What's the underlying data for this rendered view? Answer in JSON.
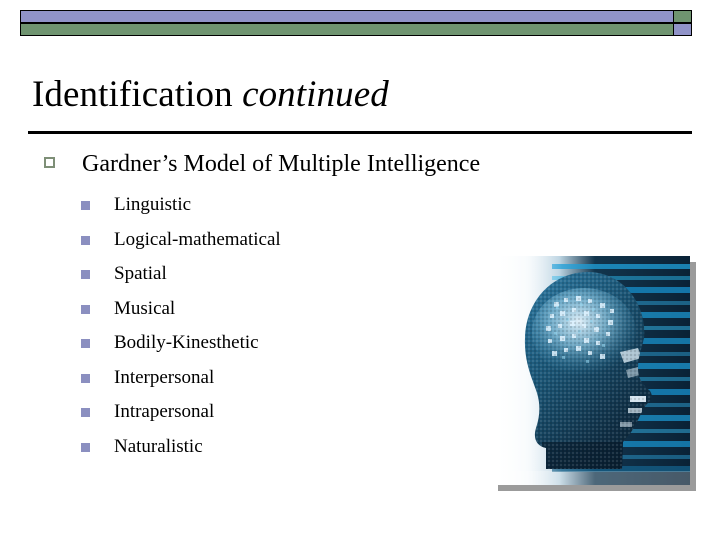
{
  "slide": {
    "title_main": "Identification ",
    "title_italic": "continued",
    "banner": {
      "name": "decorative-top-banner",
      "top_color": "#9093c8",
      "bottom_color": "#6f9470",
      "outline_color": "#000000"
    },
    "rule_color": "#000000",
    "background_color": "#ffffff"
  },
  "content": {
    "level1": [
      {
        "text": "Gardner’s Model of Multiple Intelligence",
        "bullet_icon": "hollow-square-bullet-icon",
        "bullet_color": "#7e8f77"
      }
    ],
    "level2_bullet_icon": "filled-square-bullet-icon",
    "level2_bullet_color": "#8b8fc0",
    "level2": [
      {
        "text": "Linguistic"
      },
      {
        "text": "Logical-mathematical"
      },
      {
        "text": "Spatial"
      },
      {
        "text": "Musical"
      },
      {
        "text": "Bodily-Kinesthetic"
      },
      {
        "text": "Interpersonal"
      },
      {
        "text": "Intrapersonal"
      },
      {
        "text": "Naturalistic"
      }
    ]
  },
  "figure": {
    "name": "digital-brain-head-image",
    "description": "Pixelated blue digital human head in profile with glowing brain",
    "colors": {
      "background_light": "#f2f6f8",
      "scanline_dark": "#0a2236",
      "scanline_bright": "#1f9fd8",
      "head_dark": "#113048",
      "head_mid": "#1d5a80",
      "brain_glow": "#cfe9f7",
      "shadow": "#9b9b9b"
    }
  }
}
